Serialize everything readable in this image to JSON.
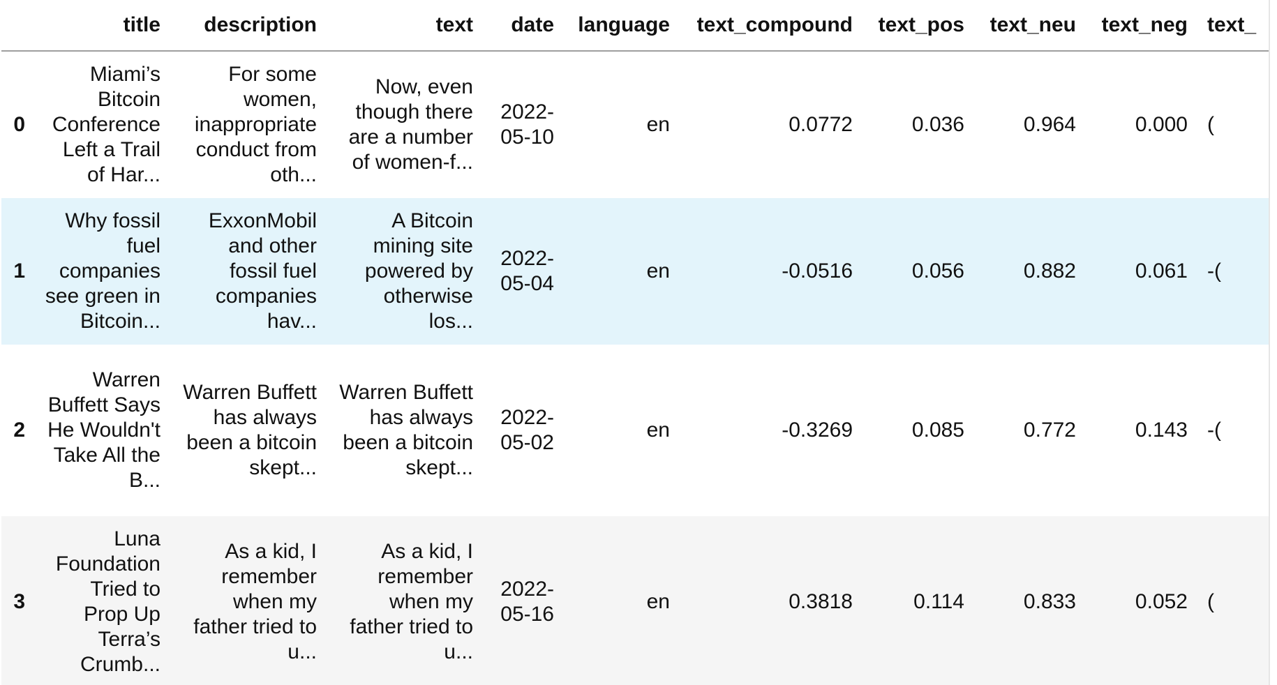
{
  "columns": [
    "",
    "title",
    "description",
    "text",
    "date",
    "language",
    "text_compound",
    "text_pos",
    "text_neu",
    "text_neg",
    "text_"
  ],
  "rows": [
    {
      "index": "0",
      "title": "Miami’s Bitcoin Conference Left a Trail of Har...",
      "description": "For some women, inappropriate conduct from oth...",
      "text": "Now, even though there are a number of women-f...",
      "date": "2022-05-10",
      "language": "en",
      "text_compound": "0.0772",
      "text_pos": "0.036",
      "text_neu": "0.964",
      "text_neg": "0.000",
      "extra": "("
    },
    {
      "index": "1",
      "title": "Why fossil fuel companies see green in Bitcoin...",
      "description": "ExxonMobil and other fossil fuel companies hav...",
      "text": "A Bitcoin mining site powered by otherwise los...",
      "date": "2022-05-04",
      "language": "en",
      "text_compound": "-0.0516",
      "text_pos": "0.056",
      "text_neu": "0.882",
      "text_neg": "0.061",
      "extra": "-("
    },
    {
      "index": "2",
      "title": "Warren Buffett Says He Wouldn't Take All the B...",
      "description": "Warren Buffett has always been a bitcoin skept...",
      "text": "Warren Buffett has always been a bitcoin skept...",
      "date": "2022-05-02",
      "language": "en",
      "text_compound": "-0.3269",
      "text_pos": "0.085",
      "text_neu": "0.772",
      "text_neg": "0.143",
      "extra": "-("
    },
    {
      "index": "3",
      "title": "Luna Foundation Tried to Prop Up Terra’s Crumb...",
      "description": "As a kid, I remember when my father tried to u...",
      "text": "As a kid, I remember when my father tried to u...",
      "date": "2022-05-16",
      "language": "en",
      "text_compound": "0.3818",
      "text_pos": "0.114",
      "text_neu": "0.833",
      "text_neg": "0.052",
      "extra": "("
    }
  ]
}
